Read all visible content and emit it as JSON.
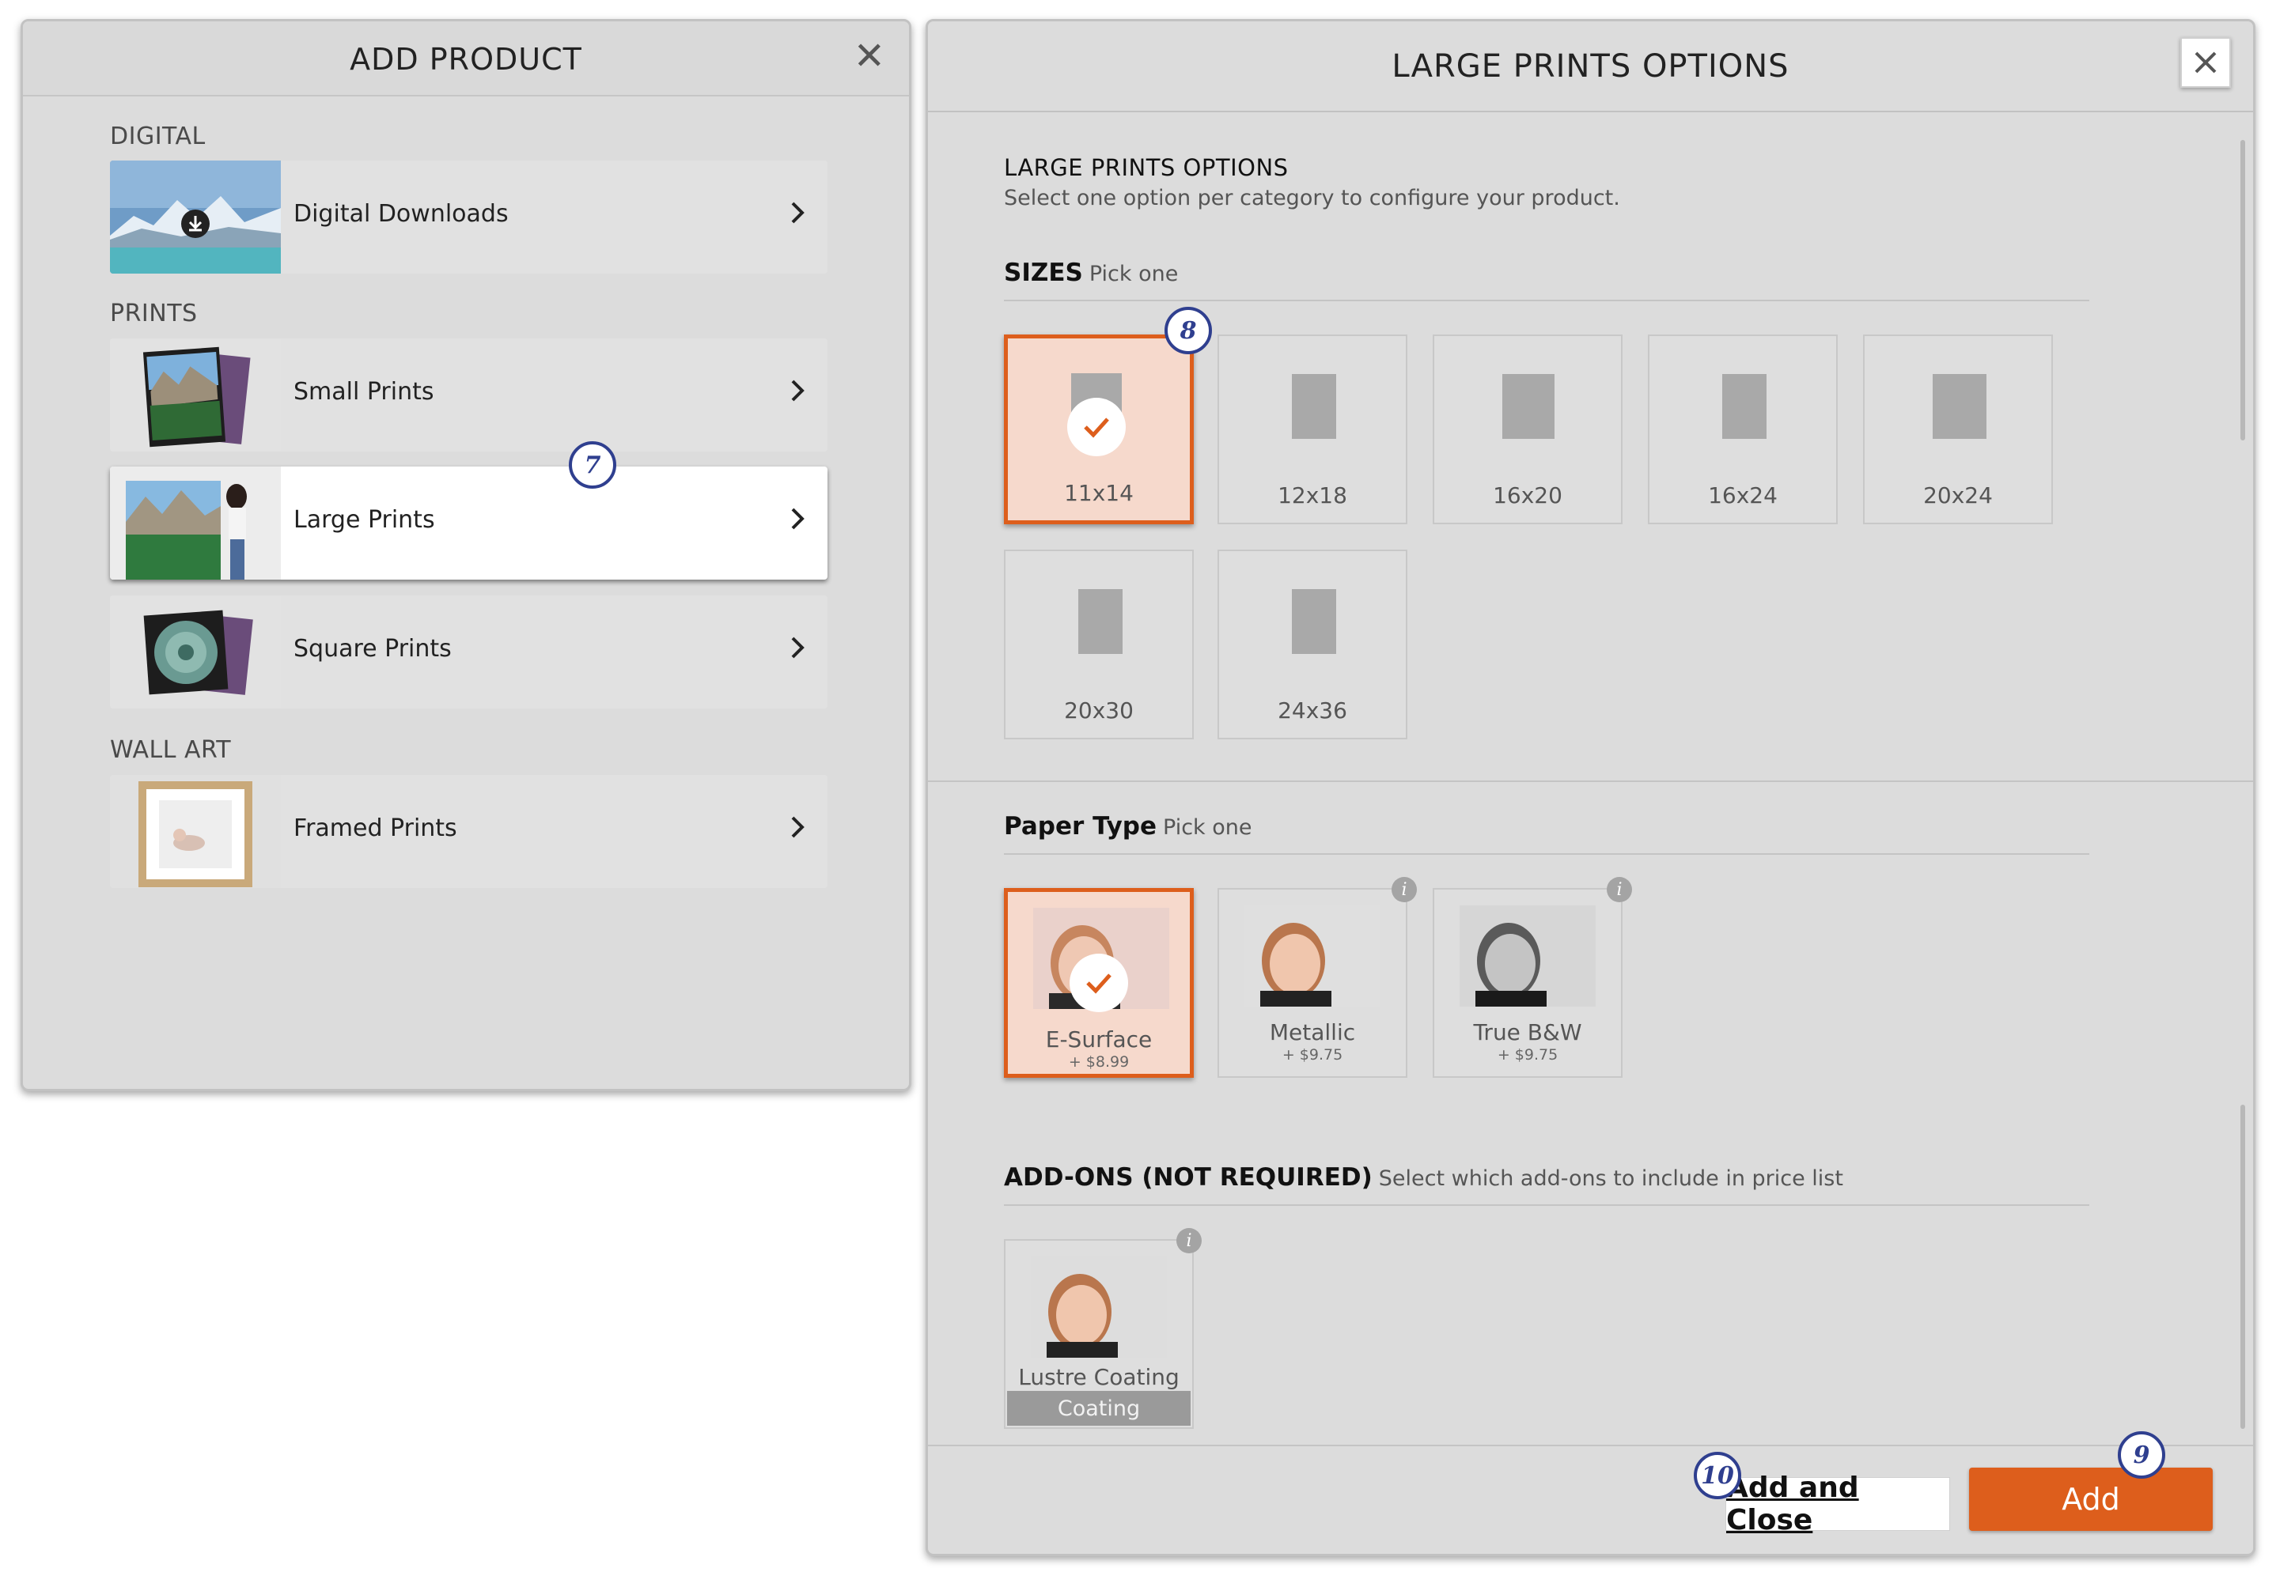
{
  "add_product": {
    "title": "ADD PRODUCT",
    "close_icon": "close-icon",
    "sections": {
      "digital": "DIGITAL",
      "prints": "PRINTS",
      "wall_art": "WALL ART"
    },
    "items": {
      "digital_downloads": "Digital Downloads",
      "small_prints": "Small Prints",
      "large_prints": "Large Prints",
      "square_prints": "Square Prints",
      "framed_prints": "Framed Prints"
    },
    "active_item": "Large Prints"
  },
  "options": {
    "title": "LARGE PRINTS OPTIONS",
    "heading": "LARGE PRINTS OPTIONS",
    "subheading": "Select one option per category to configure your product.",
    "sizes": {
      "title": "SIZES",
      "pick": "Pick one",
      "items": [
        "11x14",
        "12x18",
        "16x20",
        "16x24",
        "20x24",
        "20x30",
        "24x36"
      ],
      "selected": "11x14"
    },
    "paper": {
      "title": "Paper Type",
      "pick": "Pick one",
      "items": [
        {
          "name": "E-Surface",
          "price": "+ $8.99"
        },
        {
          "name": "Metallic",
          "price": "+ $9.75"
        },
        {
          "name": "True B&W",
          "price": "+ $9.75"
        }
      ],
      "selected": "E-Surface"
    },
    "addons": {
      "title": "ADD-ONS (NOT REQUIRED)",
      "hint": "Select which add-ons to include in price list",
      "items": [
        {
          "name": "Lustre Coating",
          "tag": "Coating"
        }
      ]
    },
    "buttons": {
      "add_and_close": "Add and Close",
      "add": "Add"
    }
  },
  "badges": {
    "b7": "7",
    "b8": "8",
    "b9": "9",
    "b10": "10"
  },
  "colors": {
    "accent": "#dd5e1c",
    "badge": "#2f3f8f",
    "selected_bg": "#f6d9cc"
  }
}
